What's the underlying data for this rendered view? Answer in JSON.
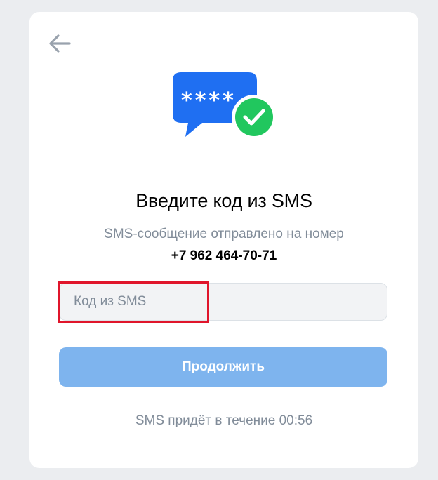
{
  "header": {
    "back_icon": "arrow-left-icon"
  },
  "illustration": {
    "bubble_text": "****",
    "bubble_color": "#1f6ff2",
    "check_color": "#21c75e",
    "icons": [
      "message-bubble-icon",
      "check-circle-icon"
    ]
  },
  "main": {
    "title": "Введите код из SMS",
    "subtitle": "SMS-сообщение отправлено на номер",
    "phone": "+7 962 464-70-71"
  },
  "form": {
    "code_value": "",
    "code_placeholder": "Код из SMS",
    "continue_label": "Продолжить",
    "continue_color": "#7eb4ee"
  },
  "footer": {
    "timer_text": "SMS придёт в течение 00:56"
  },
  "annotation": {
    "highlight_color": "#e0152b"
  }
}
